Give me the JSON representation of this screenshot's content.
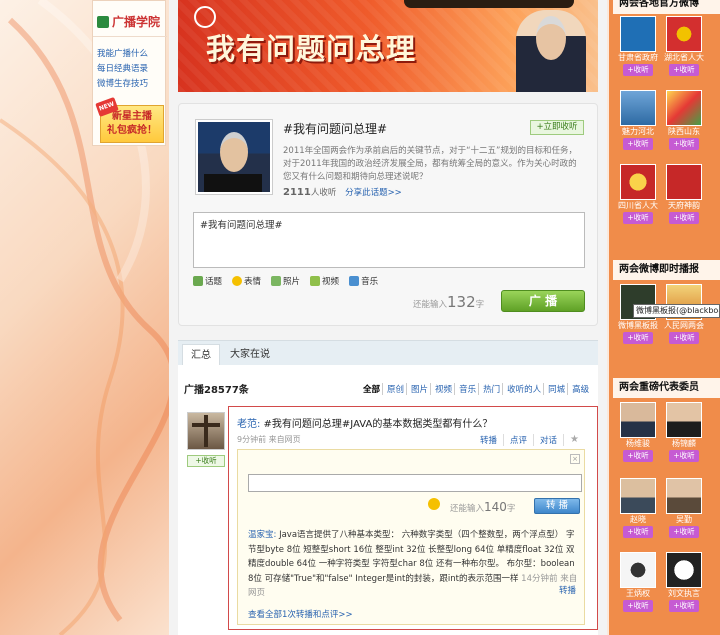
{
  "left": {
    "title": "广播学院",
    "links": [
      "我能广播什么",
      "每日经典语录",
      "微博生存技巧"
    ],
    "promo_line1": "新星主播",
    "promo_line2": "礼包疯抢！",
    "promo_badge": "NEW"
  },
  "banner": {
    "title": "我有问题问总理",
    "top_text": ""
  },
  "topic": {
    "title": "#我有问题问总理#",
    "follow": "+立即收听",
    "desc": "2011年全国两会作为承前启后的关键节点，对于“十二五”规划的目标和任务，对于2011年我国的政治经济发展全局，都有统筹全局的意义。作为关心时政的您又有什么问题和期待向总理述说呢？",
    "listeners_count": "2111",
    "listeners_suffix": "人收听",
    "share": "分享此话题>>",
    "compose_text": "#我有问题问总理#",
    "tools": [
      "话题",
      "表情",
      "照片",
      "视频",
      "音乐"
    ],
    "char_prefix": "还能输入",
    "char_count": "132",
    "char_suffix": "字",
    "post_button": "广 播"
  },
  "tabs": {
    "active": "汇总",
    "other": "大家在说"
  },
  "list": {
    "count": "广播28577条",
    "filters": [
      "全部",
      "原创",
      "图片",
      "视频",
      "音乐",
      "热门",
      "收听的人",
      "同城",
      "高级"
    ]
  },
  "feed": {
    "follow": "+收听",
    "author": "老范:",
    "text": " #我有问题问总理#JAVA的基本数据类型都有什么？",
    "meta": "9分钟前  来自网页",
    "actions": [
      "转播",
      "点评",
      "对话"
    ],
    "repost": {
      "close": "×",
      "char_prefix": "还能输入",
      "char_count": "140",
      "char_suffix": "字",
      "button": "转 播",
      "author": "温家宝:",
      "text": " Java语言提供了八种基本类型：  六种数字类型（四个整数型，两个浮点型）  字节型byte 8位 短整型short 16位 整型int 32位 长整型long 64位 单精度float 32位 双精度double 64位 一种字符类型 字符型char 8位 还有一种布尔型。 布尔型：boolean 8位 可存储\"True\"和\"false\" Integer是int的封装，跟int的表示范围一样",
      "meta": "  14分钟前  来自网页",
      "forward": "转播",
      "see_all": "查看全部1次转播和点评>>"
    }
  },
  "right": {
    "section1": "两会各地官方微博",
    "section2": "两会微博即时播报",
    "section3": "两会重磅代表委员",
    "follow_label": "+收听",
    "tooltip": "微博黑板报(@blackboard)",
    "items1": [
      "甘肃省政府",
      "湖北省人大",
      "魅力河北",
      "陕西山东",
      "四川省人大",
      "天府神韵"
    ],
    "items2": [
      "微博黑板报",
      "人民网两会"
    ],
    "items3": [
      "杨维骏",
      "杨锦麟",
      "赵晓",
      "吴勤",
      "王炳权",
      "刘文执言"
    ]
  },
  "colors": {
    "accent": "#d24a4a",
    "link": "#2a64b0",
    "green_button": "#5fa126",
    "right_bg": "#f08c4a",
    "follow_purple": "#c65bd3"
  }
}
